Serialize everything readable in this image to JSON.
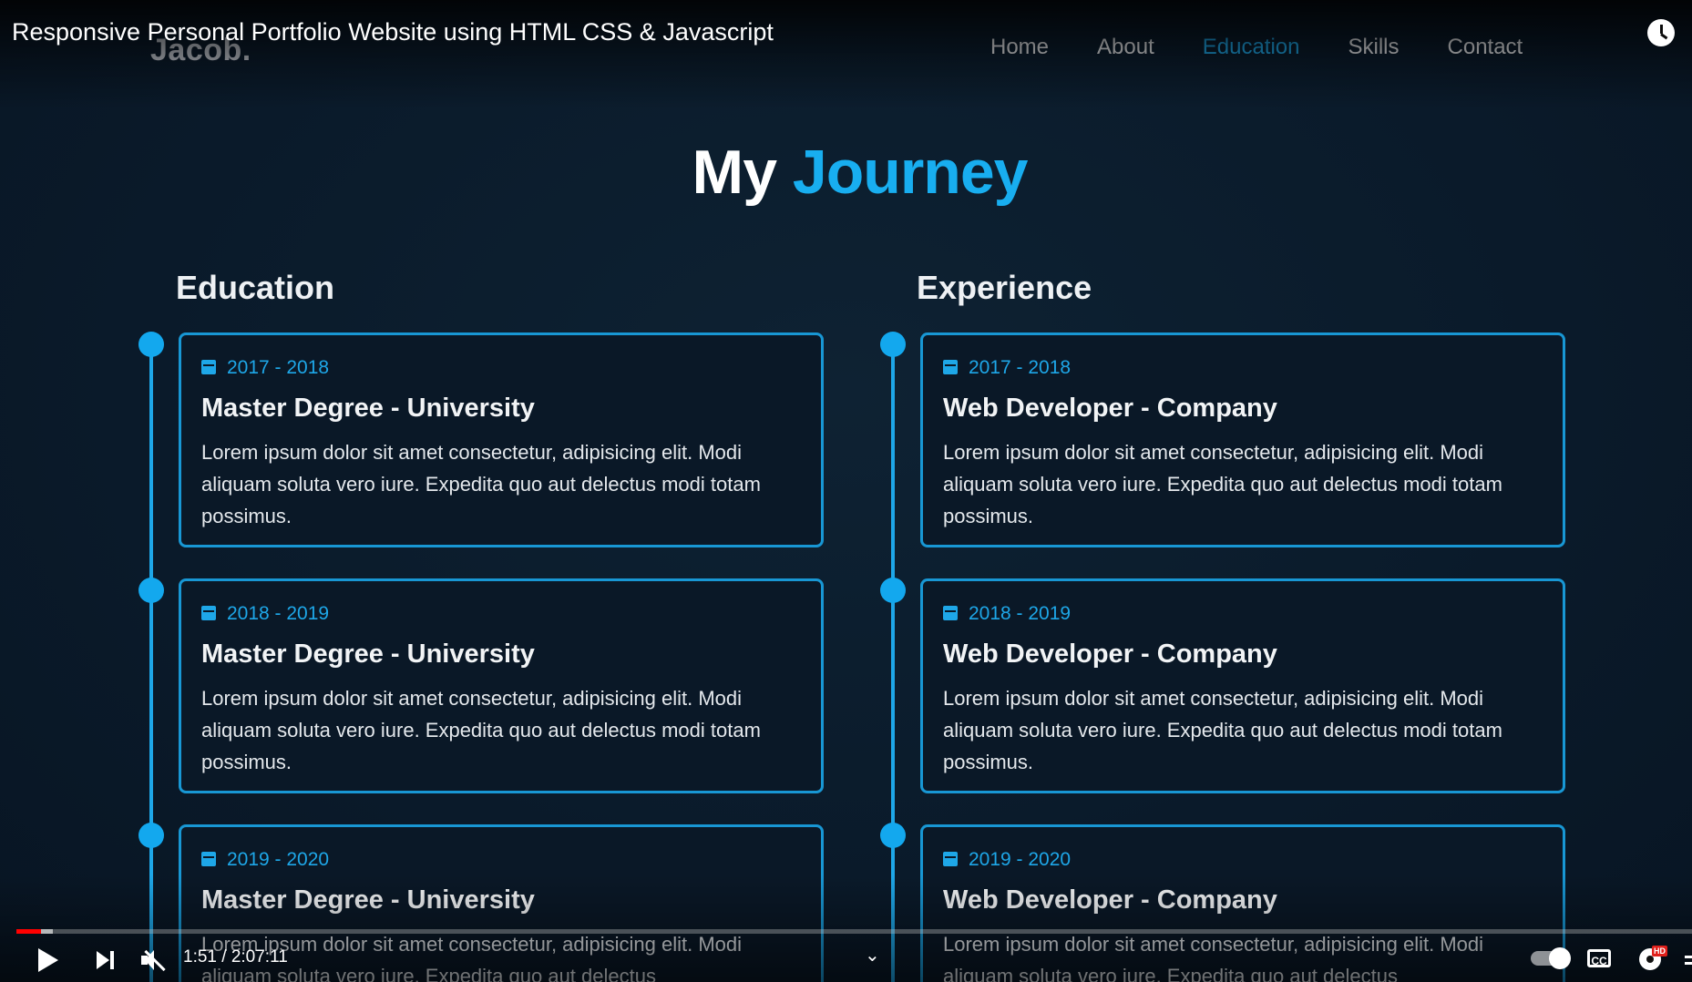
{
  "video": {
    "title": "Responsive Personal Portfolio Website using HTML CSS & Javascript",
    "time_display": "1:51 / 2:07:11",
    "progress_fraction": 0.0146
  },
  "site": {
    "logo": "Jacob.",
    "nav": [
      {
        "label": "Home",
        "active": false
      },
      {
        "label": "About",
        "active": false
      },
      {
        "label": "Education",
        "active": true
      },
      {
        "label": "Skills",
        "active": false
      },
      {
        "label": "Contact",
        "active": false
      }
    ],
    "heading": {
      "part1": "My",
      "part2": "Journey"
    },
    "columns": [
      {
        "title": "Education",
        "items": [
          {
            "date": "2017 - 2018",
            "title": "Master Degree - University",
            "desc": "Lorem ipsum dolor sit amet consectetur, adipisicing elit. Modi aliquam soluta vero iure. Expedita quo aut delectus modi totam possimus."
          },
          {
            "date": "2018 - 2019",
            "title": "Master Degree - University",
            "desc": "Lorem ipsum dolor sit amet consectetur, adipisicing elit. Modi aliquam soluta vero iure. Expedita quo aut delectus modi totam possimus."
          },
          {
            "date": "2019 - 2020",
            "title": "Master Degree - University",
            "desc": "Lorem ipsum dolor sit amet consectetur, adipisicing elit. Modi aliquam soluta vero iure. Expedita quo aut delectus"
          }
        ]
      },
      {
        "title": "Experience",
        "items": [
          {
            "date": "2017 - 2018",
            "title": "Web Developer - Company",
            "desc": "Lorem ipsum dolor sit amet consectetur, adipisicing elit. Modi aliquam soluta vero iure. Expedita quo aut delectus modi totam possimus."
          },
          {
            "date": "2018 - 2019",
            "title": "Web Developer - Company",
            "desc": "Lorem ipsum dolor sit amet consectetur, adipisicing elit. Modi aliquam soluta vero iure. Expedita quo aut delectus modi totam possimus."
          },
          {
            "date": "2019 - 2020",
            "title": "Web Developer - Company",
            "desc": "Lorem ipsum dolor sit amet consectetur, adipisicing elit. Modi aliquam soluta vero iure. Expedita quo aut delectus"
          }
        ]
      }
    ]
  },
  "player_controls": {
    "cc_label": "CC",
    "hd_badge": "HD",
    "chevron": "⌄"
  },
  "colors": {
    "accent": "#1ea7e8",
    "background": "#0a1a2b",
    "progress": "#ff0000"
  }
}
